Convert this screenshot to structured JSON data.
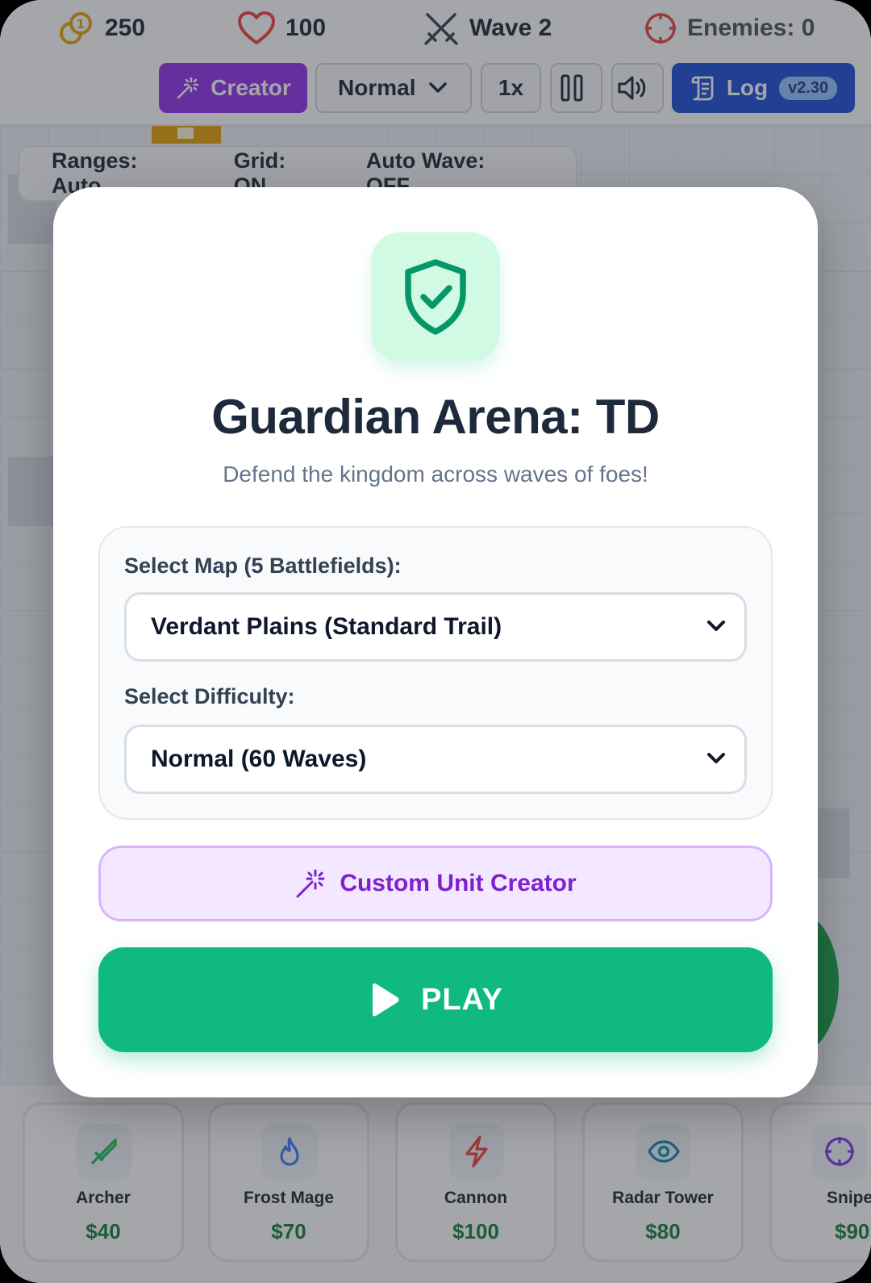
{
  "hud": {
    "gold": "250",
    "lives": "100",
    "wave": "Wave 2",
    "enemies": "Enemies: 0"
  },
  "toolbar": {
    "creator_label": "Creator",
    "speed_mode": "Normal",
    "speed_multiplier": "1x",
    "log_label": "Log",
    "version": "v2.30"
  },
  "toggles": {
    "ranges": "Ranges: Auto",
    "grid": "Grid: ON",
    "auto_wave": "Auto Wave: OFF"
  },
  "shop": {
    "units": [
      {
        "name": "Archer",
        "price": "$40",
        "icon": "sword-icon",
        "color": "#22c55e"
      },
      {
        "name": "Frost Mage",
        "price": "$70",
        "icon": "flame-icon",
        "color": "#3b82f6"
      },
      {
        "name": "Cannon",
        "price": "$100",
        "icon": "lightning-icon",
        "color": "#ef4444"
      },
      {
        "name": "Radar Tower",
        "price": "$80",
        "icon": "eye-icon",
        "color": "#0891b2"
      },
      {
        "name": "Snipe",
        "price": "$90",
        "icon": "crosshair-icon",
        "color": "#7c3aed"
      }
    ]
  },
  "modal": {
    "title": "Guardian Arena: TD",
    "subtitle": "Defend the kingdom across waves of foes!",
    "map_label": "Select Map (5 Battlefields):",
    "map_value": "Verdant Plains (Standard Trail)",
    "difficulty_label": "Select Difficulty:",
    "difficulty_value": "Normal (60 Waves)",
    "creator_button": "Custom Unit Creator",
    "play_button": "PLAY"
  },
  "colors": {
    "accent_green": "#10b981",
    "creator_purple": "#9333ea",
    "log_blue": "#1d4ed8"
  }
}
